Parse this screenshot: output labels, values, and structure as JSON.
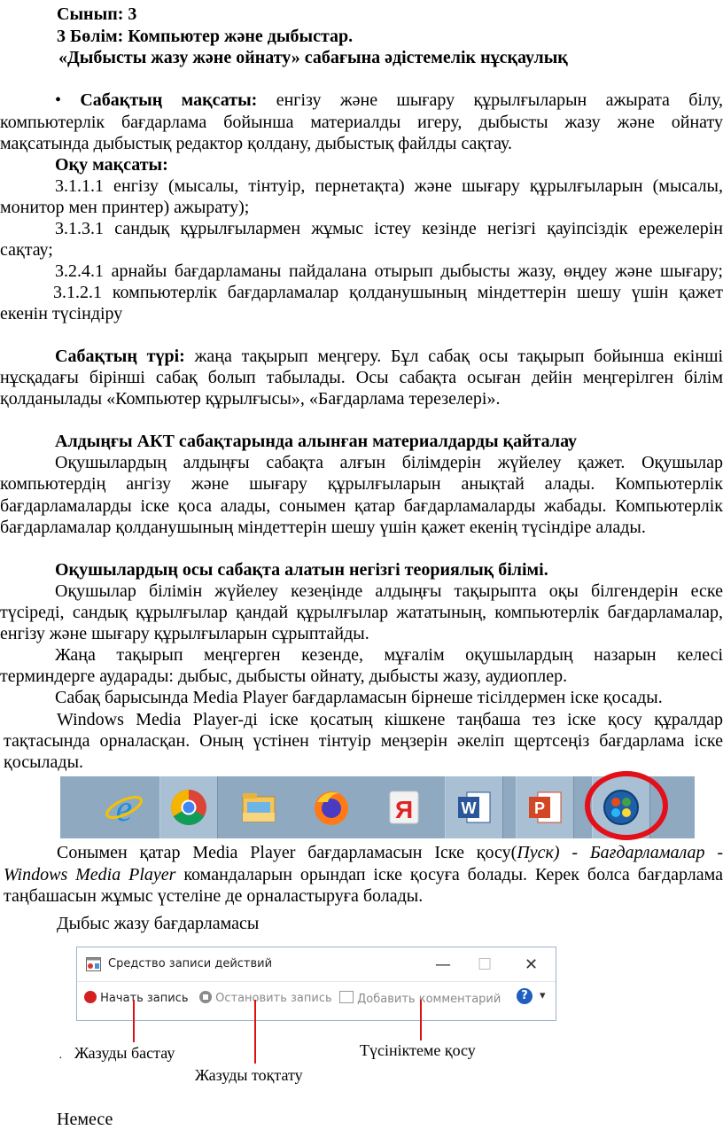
{
  "header": {
    "grade": "Сынып: 3",
    "section": "3 Бөлім: Компьютер және дыбыстар.",
    "subtitle": "«Дыбысты жазу және ойнату» сабағына әдістемелік нұсқаулық"
  },
  "goal": {
    "bullet": "•",
    "label": "Сабақтың мақсаты:",
    "line1_rest": "енгізу және шығару құрылғыларын ажырата білу,",
    "line2": "компьютерлік бағдарлама бойынша материалды игеру, дыбысты жазу және ойнату",
    "line3": "мақсатында дыбыстық редактор қолдану, дыбыстық файлды сақтау."
  },
  "objectives": {
    "label": "Оқу мақсаты:",
    "o1_line1": "3.1.1.1 енгізу (мысалы, тінтуір, пернетақта) және шығару құрылғыларын (мысалы,",
    "o1_line2": "монитор мен принтер) ажырату);",
    "o2_line1": "3.1.3.1 сандық құрылғылармен жұмыс істеу кезінде негізгі қауіпсіздік ережелерін",
    "o2_line2": "сақтау;",
    "o3": "3.2.4.1 арнайы бағдарламаны пайдалана отырып дыбысты жазу, өңдеу және шығару;",
    "o4_line1": "3.1.2.1 компьютерлік бағдарламалар қолданушының міндеттерін шешу үшін қажет",
    "o4_line2": "екенін түсіндіру"
  },
  "lesson_type": {
    "label": "Сабақтың түрі:",
    "line1_rest": "жаңа тақырып меңгеру. Бұл сабақ осы тақырып бойынша екінші",
    "line2": "нұсқадағы бірінші сабақ болып табылады. Осы сабақта осыған дейін меңгерілген білім",
    "line3": "қолданылады «Компьютер құрылғысы», «Бағдарлама терезелері»."
  },
  "review": {
    "heading": "Алдыңғы АКТ сабақтарында алынған материалдарды қайталау",
    "line1": "Оқушылардың алдыңғы сабақта алғын білімдерін жүйелеу қажет. Оқушылар",
    "line2": "компьютердің ангізу және шығару құрылғыларын анықтай алады. Компьютерлік",
    "line3": "бағдарламаларды іске қоса алады, сонымен қатар бағдарламаларды жабады. Компьютерлік",
    "line4": "бағдарламалар қолданушының міндеттерін шешу үшін қажет екенің түсіндіре алады."
  },
  "theory": {
    "heading": "Оқушылардың осы сабақта алатын негізгі теориялық білімі.",
    "p1_line1": "Оқушылар білімін жүйелеу кезеңінде алдыңғы тақырыпта оқы білгендерін еске",
    "p1_line2": "түсіреді, сандық құрылғылар қандай құрылғылар жататының, компьютерлік бағдарламалар,",
    "p1_line3": "енгізу және шығару құрылғыларын сұрыптайды.",
    "p2_line1": "Жаңа тақырып меңгерген кезенде, мұғалім оқушылардың назарын келесі",
    "p2_line2": "терминдерге аударады: дыбыс, дыбысты ойнату, дыбысты жазу, аудиоплер.",
    "p3": "Сабақ барысында Media Player бағдарламасын бірнеше тісілдермен іске қосады.",
    "p4_line1": "Windows Media Player-ді іске қосатың кішкене таңбаша тез іске қосу құралдар",
    "p4_line2": "тақтасында орналасқан. Оның үстінен тінтуір меңзерін әкеліп щертсеңіз бағдарлама іске",
    "p4_line3": "қосылады."
  },
  "taskbar": {
    "icons": [
      "internet-explorer-icon",
      "chrome-icon",
      "file-explorer-icon",
      "firefox-icon",
      "yandex-icon",
      "word-icon",
      "powerpoint-icon",
      "windows-media-player-icon"
    ],
    "highlight_color": "#e3101a"
  },
  "after": {
    "l1_a": "Сонымен қатар Media Player бағдарламасын Іске қосу(",
    "l1_b": "Пуск) - Бағдарламалар -",
    "l2_a": "Windows Media Player",
    "l2_b": " командаларын орындап іске қосуға болады. Керек болса бағдарлама",
    "l3": "таңбашасын жұмыс үстеліне де орналастыруға болады.",
    "recorder_caption": "Дыбыс жазу бағдарламасы"
  },
  "recorder": {
    "title": "Средство записи действий",
    "start": "Начать запись",
    "stop": "Остановить запись",
    "comment": "Добавить комментарий",
    "minimize": "—",
    "maximize": "☐",
    "close": "✕",
    "help": "?",
    "dropdown": "▾"
  },
  "captions": {
    "start": "Жазуды бастау",
    "stop": "Жазуды тоқтату",
    "comment": "Түсініктеме қосу",
    "dot": "·"
  },
  "footer": "Немесе"
}
